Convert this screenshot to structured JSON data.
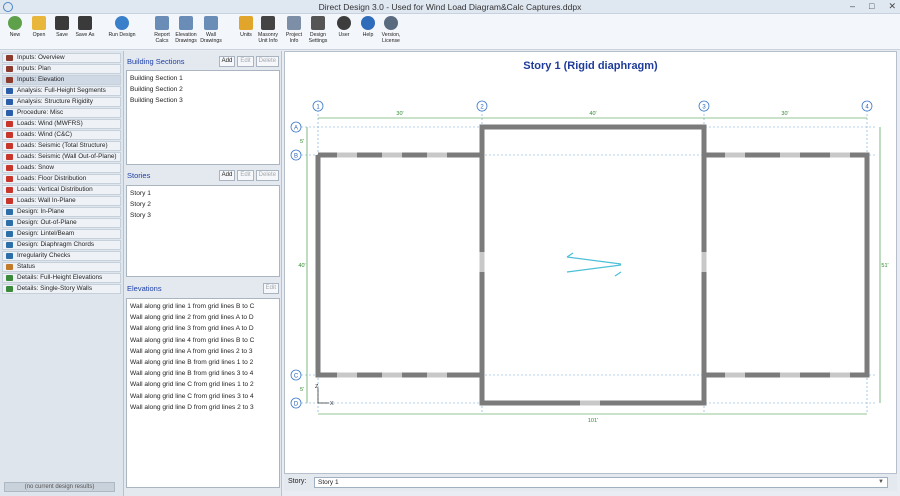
{
  "window": {
    "title": "Direct Design 3.0  -  Used for Wind Load Diagram&Calc Captures.ddpx",
    "controls": [
      "–",
      "□",
      "✕"
    ]
  },
  "ribbon": [
    {
      "label": "New",
      "icon": "new-icon",
      "color": "#5fa04a"
    },
    {
      "label": "Open",
      "icon": "open-icon",
      "color": "#e8b63a"
    },
    {
      "label": "Save",
      "icon": "save-icon",
      "color": "#3a3a3a"
    },
    {
      "label": "Save As",
      "icon": "save-as-icon",
      "color": "#3a3a3a"
    },
    {
      "label": "Run Design",
      "icon": "run-design-icon",
      "color": "#3a7fc9"
    },
    {
      "label": "Report Calcs",
      "icon": "report-icon",
      "color": "#6a8db8"
    },
    {
      "label": "Elevation Drawings",
      "icon": "elevation-drawings-icon",
      "color": "#6a8db8"
    },
    {
      "label": "Wall Drawings",
      "icon": "wall-drawings-icon",
      "color": "#6a8db8"
    },
    {
      "label": "Units",
      "icon": "units-icon",
      "color": "#e2a52b"
    },
    {
      "label": "Masonry Unit Info",
      "icon": "masonry-icon",
      "color": "#444444"
    },
    {
      "label": "Project Info",
      "icon": "project-info-icon",
      "color": "#7c8fa6"
    },
    {
      "label": "Design Settings",
      "icon": "settings-icon",
      "color": "#555555"
    },
    {
      "label": "User",
      "icon": "user-icon",
      "color": "#3d3d3d"
    },
    {
      "label": "Help",
      "icon": "help-icon",
      "color": "#2f6cba"
    },
    {
      "label": "Version, License",
      "icon": "version-icon",
      "color": "#5a6b80"
    }
  ],
  "nav": [
    {
      "label": "Inputs: Overview",
      "icon": "book-icon",
      "color": "#8b3c2c",
      "selected": false
    },
    {
      "label": "Inputs: Plan",
      "icon": "book-icon",
      "color": "#8b3c2c",
      "selected": false
    },
    {
      "label": "Inputs: Elevation",
      "icon": "book-icon",
      "color": "#8b3c2c",
      "selected": true
    },
    {
      "label": "Analysis: Full-Height Segments",
      "icon": "analysis-icon",
      "color": "#2b5ea8",
      "selected": false
    },
    {
      "label": "Analysis: Structure Rigidity",
      "icon": "analysis-icon",
      "color": "#2b5ea8",
      "selected": false
    },
    {
      "label": "Procedure: Misc",
      "icon": "procedure-icon",
      "color": "#2b5ea8",
      "selected": false
    },
    {
      "label": "Loads: Wind (MWFRS)",
      "icon": "load-icon",
      "color": "#c8352a",
      "selected": false
    },
    {
      "label": "Loads: Wind (C&C)",
      "icon": "load-icon",
      "color": "#c8352a",
      "selected": false
    },
    {
      "label": "Loads: Seismic (Total Structure)",
      "icon": "load-icon",
      "color": "#c8352a",
      "selected": false
    },
    {
      "label": "Loads: Seismic (Wall Out-of-Plane)",
      "icon": "load-icon",
      "color": "#c8352a",
      "selected": false
    },
    {
      "label": "Loads: Snow",
      "icon": "load-icon",
      "color": "#c8352a",
      "selected": false
    },
    {
      "label": "Loads: Floor Distribution",
      "icon": "load-icon",
      "color": "#c8352a",
      "selected": false
    },
    {
      "label": "Loads: Vertical Distribution",
      "icon": "load-icon",
      "color": "#c8352a",
      "selected": false
    },
    {
      "label": "Loads: Wall In-Plane",
      "icon": "load-icon",
      "color": "#c8352a",
      "selected": false
    },
    {
      "label": "Design: In-Plane",
      "icon": "design-icon",
      "color": "#2b6ea8",
      "selected": false
    },
    {
      "label": "Design: Out-of-Plane",
      "icon": "design-icon",
      "color": "#2b6ea8",
      "selected": false
    },
    {
      "label": "Design: Lintel/Beam",
      "icon": "design-icon",
      "color": "#2b6ea8",
      "selected": false
    },
    {
      "label": "Design: Diaphragm Chords",
      "icon": "design-icon",
      "color": "#2b6ea8",
      "selected": false
    },
    {
      "label": "Irregularity Checks",
      "icon": "check-icon",
      "color": "#2b6ea8",
      "selected": false
    },
    {
      "label": "Status",
      "icon": "status-icon",
      "color": "#c07a2a",
      "selected": false
    },
    {
      "label": "Details: Full-Height Elevations",
      "icon": "details-icon",
      "color": "#3b8a3b",
      "selected": false
    },
    {
      "label": "Details: Single-Story Walls",
      "icon": "details-icon",
      "color": "#3b8a3b",
      "selected": false
    }
  ],
  "no_results": "(no current design results)",
  "sections": {
    "building": {
      "title": "Building Sections",
      "buttons": [
        "Add",
        "Edit",
        "Delete"
      ],
      "items": [
        "Building Section 1",
        "Building Section 2",
        "Building Section 3"
      ]
    },
    "stories": {
      "title": "Stories",
      "buttons": [
        "Add",
        "Edit",
        "Delete"
      ],
      "items": [
        "Story 1",
        "Story 2",
        "Story 3"
      ]
    },
    "elevations": {
      "title": "Elevations",
      "buttons": [
        "Edit"
      ],
      "items": [
        "Wall along grid line 1 from grid lines B to C",
        "Wall along grid line 2 from grid lines A to D",
        "Wall along grid line 3 from grid lines A to D",
        "Wall along grid line 4 from grid lines B to C",
        "Wall along grid line A from grid lines 2 to 3",
        "Wall along grid line B from grid lines 1 to 2",
        "Wall along grid line B from grid lines 3 to 4",
        "Wall along grid line C from grid lines 1 to 2",
        "Wall along grid line C from grid lines 3 to 4",
        "Wall along grid line D from grid lines 2 to 3"
      ]
    }
  },
  "plan": {
    "title": "Story 1 (Rigid diaphragm)",
    "grid_cols": [
      "1",
      "2",
      "3",
      "4"
    ],
    "grid_rows": [
      "A",
      "B",
      "C",
      "D"
    ],
    "dims_top": [
      "30'",
      "40'",
      "30'"
    ],
    "dim_total": "101'",
    "dim_left": "40'",
    "dim_right": "51'",
    "dim_top_small": "5'",
    "dim_bottom_small": "5'",
    "axis_z": "Z",
    "axis_x": "X"
  },
  "story_select": {
    "label": "Story:",
    "value": "Story 1"
  }
}
